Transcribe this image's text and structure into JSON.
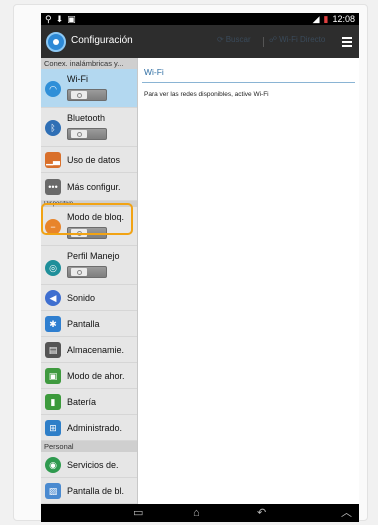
{
  "statusbar": {
    "time": "12:08"
  },
  "actionbar": {
    "title": "Configuración",
    "scan_label": "Buscar",
    "wifi_direct_label": "Wi-Fi Directo"
  },
  "sidebar": {
    "sections": {
      "wireless": "Conex. inalámbricas y...",
      "device": "Dispositivo",
      "personal": "Personal"
    },
    "items": {
      "wifi": "Wi-Fi",
      "bluetooth": "Bluetooth",
      "data_usage": "Uso de datos",
      "more_settings": "Más configur.",
      "block_mode": "Modo de bloq.",
      "handling_profile": "Perfil Manejo",
      "sound": "Sonido",
      "display": "Pantalla",
      "storage": "Almacenamie.",
      "power_saving": "Modo de ahor.",
      "battery": "Batería",
      "app_manager": "Administrado.",
      "location_services": "Servicios de.",
      "lock_screen": "Pantalla de bl."
    }
  },
  "main": {
    "title": "Wi-Fi",
    "hint": "Para ver las redes disponibles, active Wi-Fi"
  },
  "colors": {
    "selected_row": "#b3d8f0",
    "highlight_outline": "#f1a314",
    "header_accent": "#2f6ea3"
  }
}
